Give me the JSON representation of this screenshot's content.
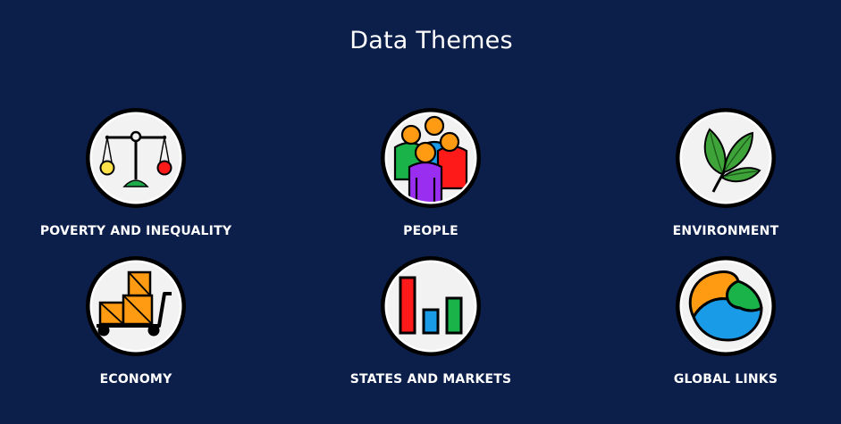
{
  "page": {
    "title": "Data Themes",
    "background": "#0c1f4b"
  },
  "themes": [
    {
      "label": "POVERTY AND INEQUALITY",
      "icon": "scales-icon"
    },
    {
      "label": "PEOPLE",
      "icon": "people-group-icon"
    },
    {
      "label": "ENVIRONMENT",
      "icon": "leaves-icon"
    },
    {
      "label": "ECONOMY",
      "icon": "hand-truck-boxes-icon"
    },
    {
      "label": "STATES AND MARKETS",
      "icon": "bar-chart-icon"
    },
    {
      "label": "GLOBAL LINKS",
      "icon": "pie-chart-icon"
    }
  ]
}
